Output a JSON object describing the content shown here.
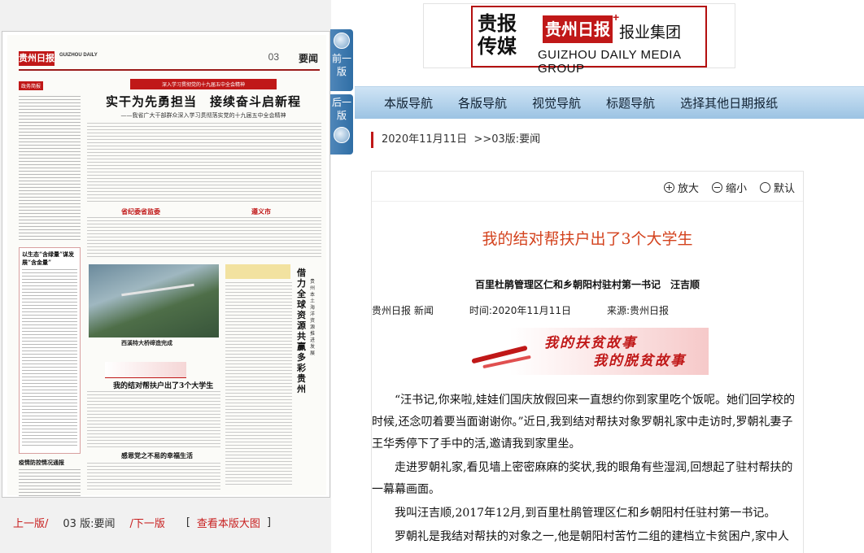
{
  "logo": {
    "cn_left": "贵报传媒",
    "cn_red": "贵州日报",
    "plus": "+",
    "group": "报业集团",
    "en": "GUIZHOU DAILY MEDIA GROUP"
  },
  "nav": {
    "items": [
      "本版导航",
      "各版导航",
      "视觉导航",
      "标题导航",
      "选择其他日期报纸"
    ]
  },
  "breadcrumb": "2020年11月11日  >>03版:要闻",
  "zoom": {
    "enlarge": "放大",
    "shrink": "缩小",
    "default": "默认"
  },
  "article": {
    "title": "我的结对帮扶户出了3个大学生",
    "subtitle": "百里杜鹃管理区仁和乡朝阳村驻村第一书记　汪吉顺",
    "source_label": "贵州日报 新闻",
    "time": "时间:2020年11月11日",
    "origin": "来源:贵州日报",
    "banner_line1": "我的扶贫故事",
    "banner_line2": "我的脱贫故事",
    "paragraphs": [
      "“汪书记,你来啦,娃娃们国庆放假回来一直想约你到家里吃个饭呢。她们回学校的时候,还念叨着要当面谢谢你。”近日,我到结对帮扶对象罗朝礼家中走访时,罗朝礼妻子王华秀停下了手中的活,邀请我到家里坐。",
      "走进罗朝礼家,看见墙上密密麻麻的奖状,我的眼角有些湿润,回想起了驻村帮扶的一幕幕画面。",
      "我叫汪吉顺,2017年12月,到百里杜鹃管理区仁和乡朝阳村任驻村第一书记。",
      "罗朝礼是我结对帮扶的对象之一,他是朝阳村苦竹二组的建档立卡贫困户,家中人"
    ]
  },
  "newspaper": {
    "logo": "贵州日报",
    "en": "GUIZHOU DAILY",
    "page": "03",
    "section": "要闻",
    "banner": "深入学习贯彻党的十九届五中全会精神",
    "headline": "实干为先勇担当　接续奋斗启新程",
    "subheadline": "——我省广大干部群众深入学习贯彻落实党的十九届五中全会精神",
    "photo_caption": "西溪特大桥缔造完成",
    "story_title": "我的结对帮扶户出了3个大学生",
    "vertical_title": "借力全球资源　共赢多彩贵州",
    "vertical_sub": "贵州本土海洋资源推进发展",
    "left_tag": "政务简报",
    "box1_title": "以生态“含绿量”谋发展“含金量”",
    "box2_title": "疫情防控情况通报",
    "sub1": "省纪委省监委",
    "sub2": "遵义市",
    "sub3": "感恩党之不易的幸福生活"
  },
  "page_nav": {
    "prev": "前一版",
    "next": "后一版"
  },
  "pager": {
    "prev": "上一版/",
    "current": "03 版:要闻",
    "next": "/下一版",
    "bracket_open": "[",
    "view_large": "查看本版大图",
    "bracket_close": "]"
  }
}
